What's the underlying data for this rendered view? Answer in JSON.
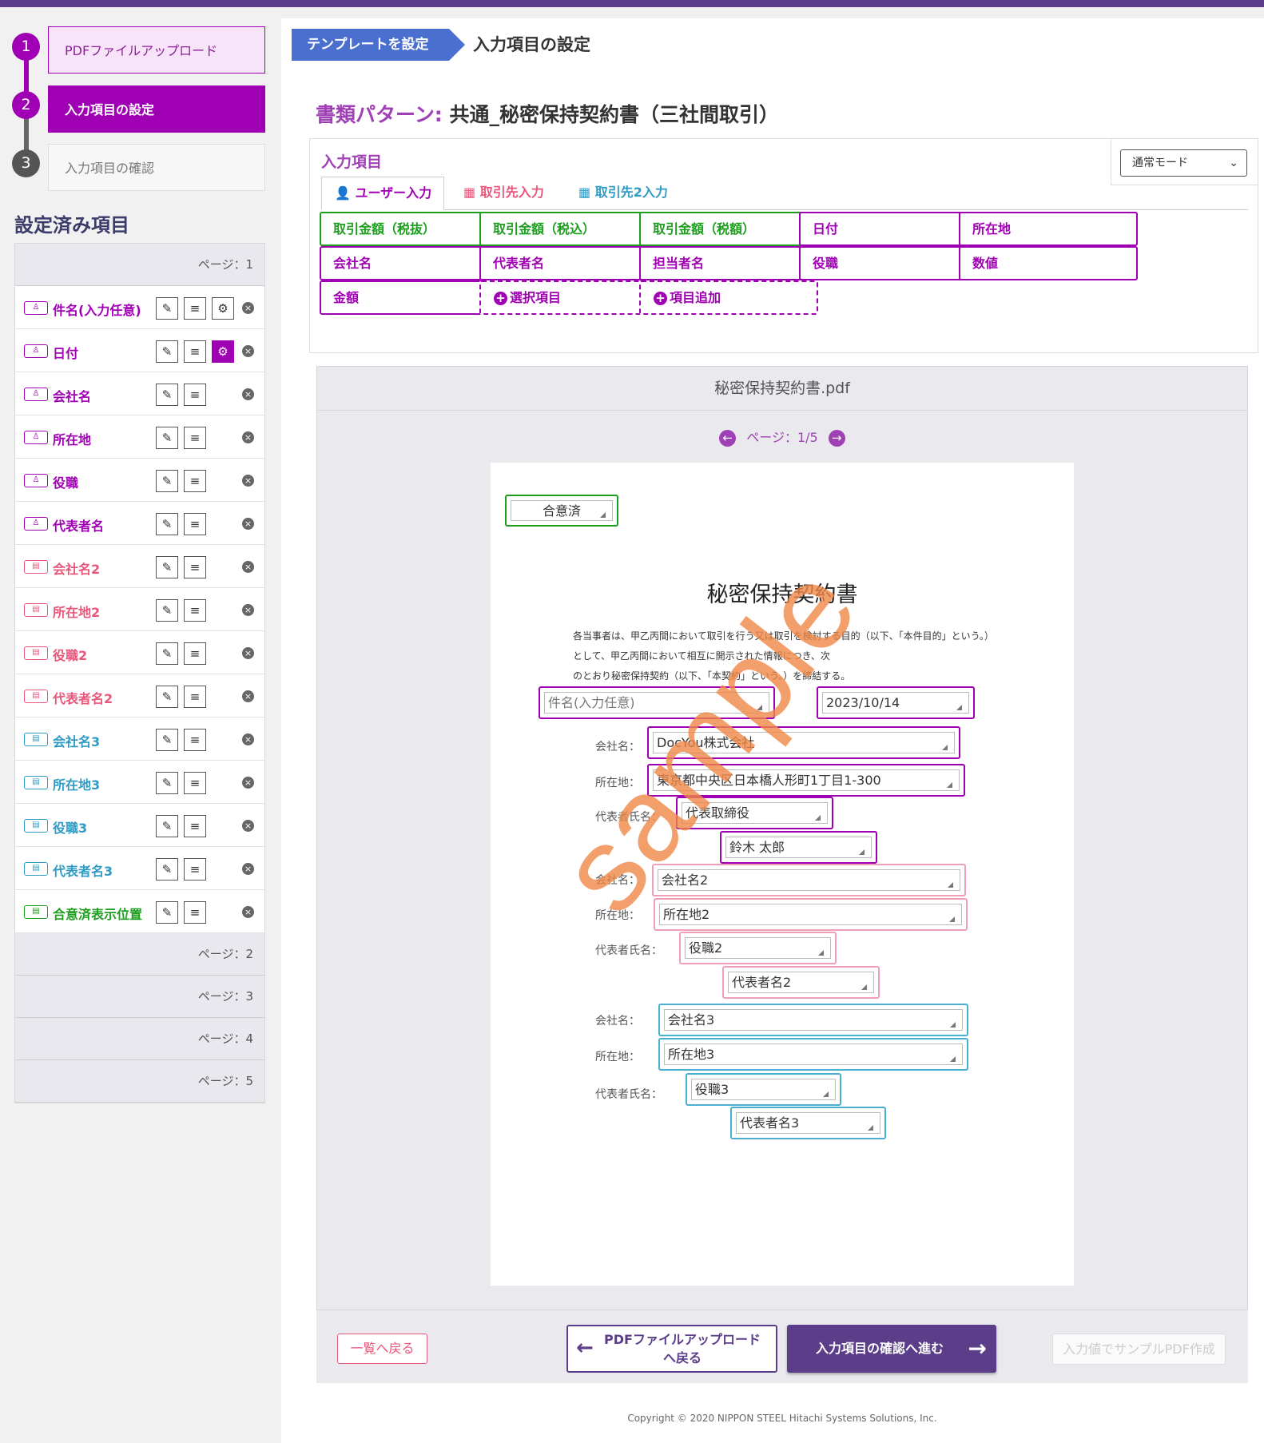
{
  "steps": [
    {
      "num": "1",
      "label": "PDFファイルアップロード"
    },
    {
      "num": "2",
      "label": "入力項目の設定"
    },
    {
      "num": "3",
      "label": "入力項目の確認"
    }
  ],
  "sidebar": {
    "title": "設定済み項目",
    "page1": "ページ：1",
    "items": [
      {
        "label": "件名(入力任意)",
        "type": "user"
      },
      {
        "label": "日付",
        "type": "user"
      },
      {
        "label": "会社名",
        "type": "user"
      },
      {
        "label": "所在地",
        "type": "user"
      },
      {
        "label": "役職",
        "type": "user"
      },
      {
        "label": "代表者名",
        "type": "user"
      },
      {
        "label": "会社名2",
        "type": "partner"
      },
      {
        "label": "所在地2",
        "type": "partner"
      },
      {
        "label": "役職2",
        "type": "partner"
      },
      {
        "label": "代表者名2",
        "type": "partner"
      },
      {
        "label": "会社名3",
        "type": "partner2"
      },
      {
        "label": "所在地3",
        "type": "partner2"
      },
      {
        "label": "役職3",
        "type": "partner2"
      },
      {
        "label": "代表者名3",
        "type": "partner2"
      },
      {
        "label": "合意済表示位置",
        "type": "agreed"
      }
    ],
    "pages": [
      "ページ：2",
      "ページ：3",
      "ページ：4",
      "ページ：5"
    ]
  },
  "breadcrumb": {
    "template": "テンプレートを設定",
    "current": "入力項目の設定"
  },
  "doc": {
    "label": "書類パターン:",
    "name": "共通_秘密保持契約書（三社間取引）"
  },
  "input_panel": {
    "title": "入力項目",
    "mode": "通常モード",
    "tabs": [
      "ユーザー入力",
      "取引先入力",
      "取引先2入力"
    ],
    "fields": [
      {
        "label": "取引金額（税抜）",
        "kind": "green"
      },
      {
        "label": "取引金額（税込）",
        "kind": "green"
      },
      {
        "label": "取引金額（税額）",
        "kind": "green"
      },
      {
        "label": "日付",
        "kind": "purple"
      },
      {
        "label": "所在地",
        "kind": "purple"
      },
      {
        "label": "会社名",
        "kind": "purple"
      },
      {
        "label": "代表者名",
        "kind": "purple"
      },
      {
        "label": "担当者名",
        "kind": "purple"
      },
      {
        "label": "役職",
        "kind": "purple"
      },
      {
        "label": "数値",
        "kind": "purple"
      },
      {
        "label": "金額",
        "kind": "purple"
      },
      {
        "label": "選択項目",
        "kind": "add"
      },
      {
        "label": "項目追加",
        "kind": "add"
      }
    ]
  },
  "viewer": {
    "filename": "秘密保持契約書.pdf",
    "pager": "ページ：1/5",
    "doc_title": "秘密保持契約書",
    "agreed": "合意済",
    "paragraph": [
      "各当事者は、甲乙丙間において取引を行う又は取引を検討する目的（以下、「本件目的」という。）",
      "として、甲乙丙間において相互に開示された情報につき、次",
      "のとおり秘密保持契約（以下、「本契約」という。）を締結する。"
    ],
    "subject": "件名(入力任意)",
    "date": "2023/10/14",
    "labels": {
      "company": "会社名：",
      "address": "所在地：",
      "rep": "代表者氏名："
    },
    "party1": {
      "company": "DocYou株式会社",
      "address": "東京都中央区日本橋人形町1丁目1-300",
      "title": "代表取締役",
      "name": "鈴木 太郎"
    },
    "party2": {
      "company": "会社名2",
      "address": "所在地2",
      "title": "役職2",
      "name": "代表者名2"
    },
    "party3": {
      "company": "会社名3",
      "address": "所在地3",
      "title": "役職3",
      "name": "代表者名3"
    },
    "watermark": "sample"
  },
  "footer": {
    "back_list": "一覧へ戻る",
    "back_pdf_1": "PDFファイルアップロード",
    "back_pdf_2": "へ戻る",
    "next": "入力項目の確認へ進む",
    "sample_pdf": "入力値でサンプルPDF作成",
    "copyright": "Copyright © 2020 NIPPON STEEL Hitachi Systems Solutions, Inc."
  },
  "colors": {
    "accent": "#a000b3",
    "partner": "#e9567a",
    "partner2": "#2f9bc4",
    "agreed": "#1e9e1e",
    "primary": "#5b3d8a"
  }
}
